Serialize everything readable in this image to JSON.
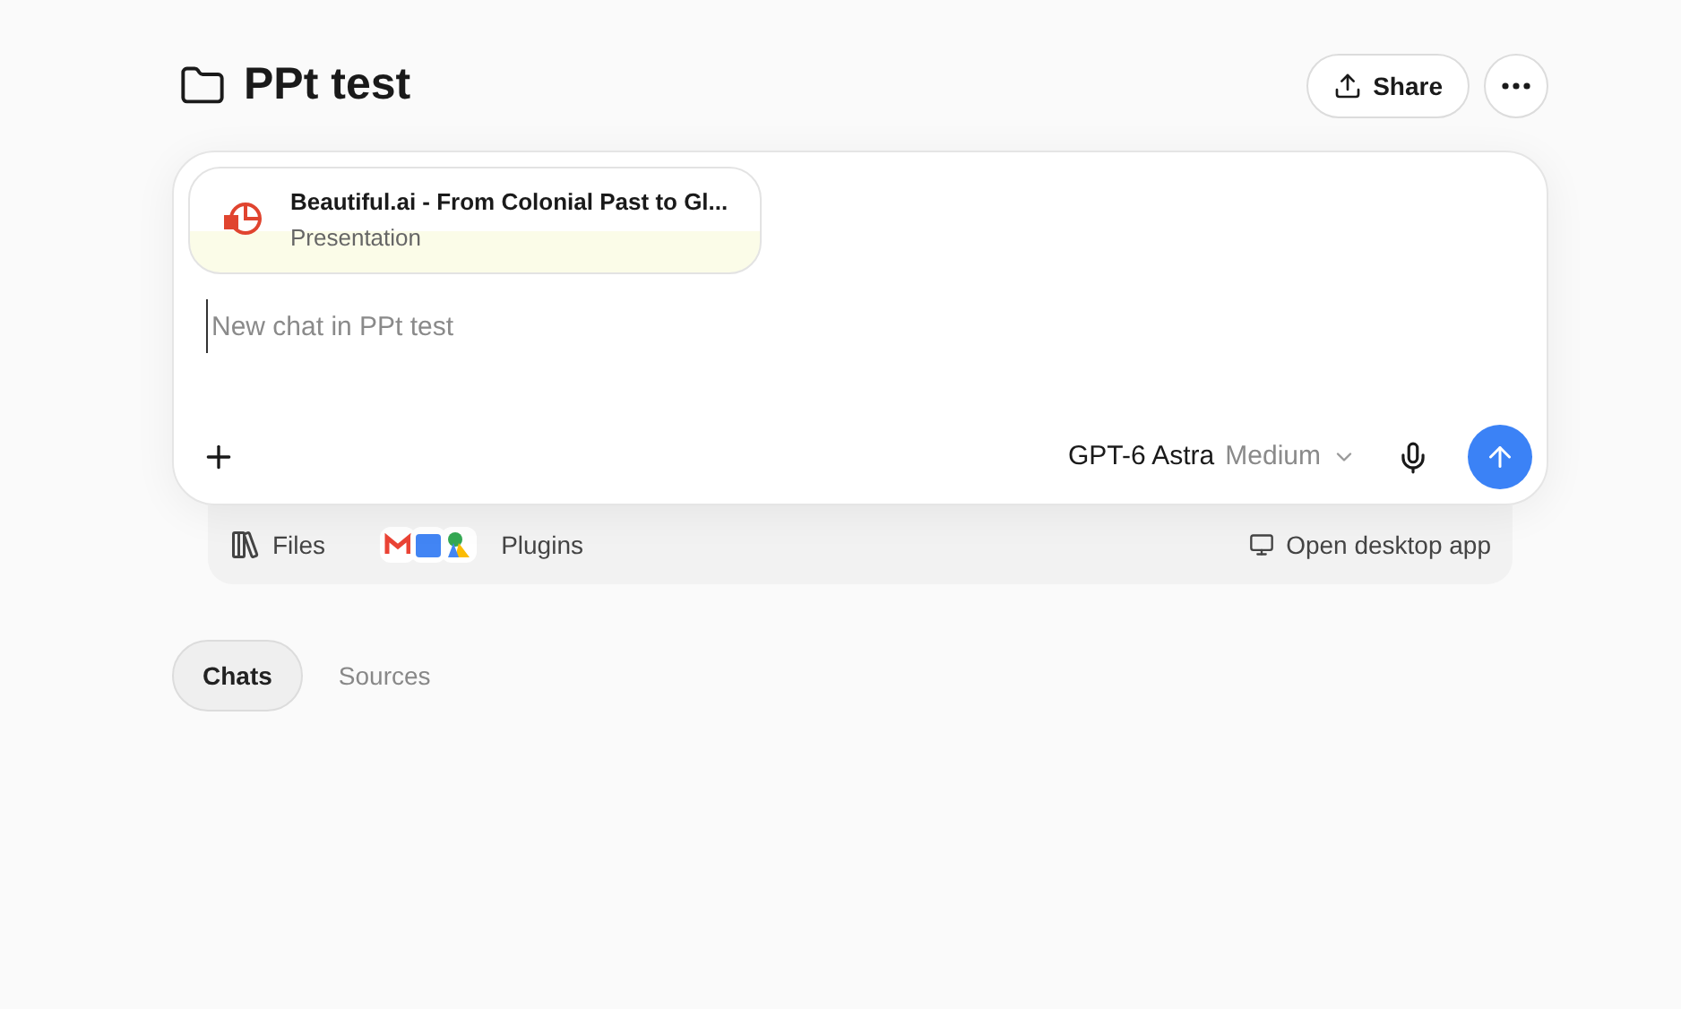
{
  "header": {
    "title": "PPt test",
    "share_label": "Share"
  },
  "composer": {
    "attachment": {
      "title": "Beautiful.ai - From Colonial Past to Gl...",
      "subtitle": "Presentation"
    },
    "placeholder": "New chat in PPt test",
    "model": "GPT-6 Astra",
    "effort": "Medium"
  },
  "footer_bar": {
    "files_label": "Files",
    "plugins_label": "Plugins",
    "desktop_label": "Open desktop app"
  },
  "tabs": [
    {
      "label": "Chats",
      "selected": true
    },
    {
      "label": "Sources",
      "selected": false
    }
  ]
}
